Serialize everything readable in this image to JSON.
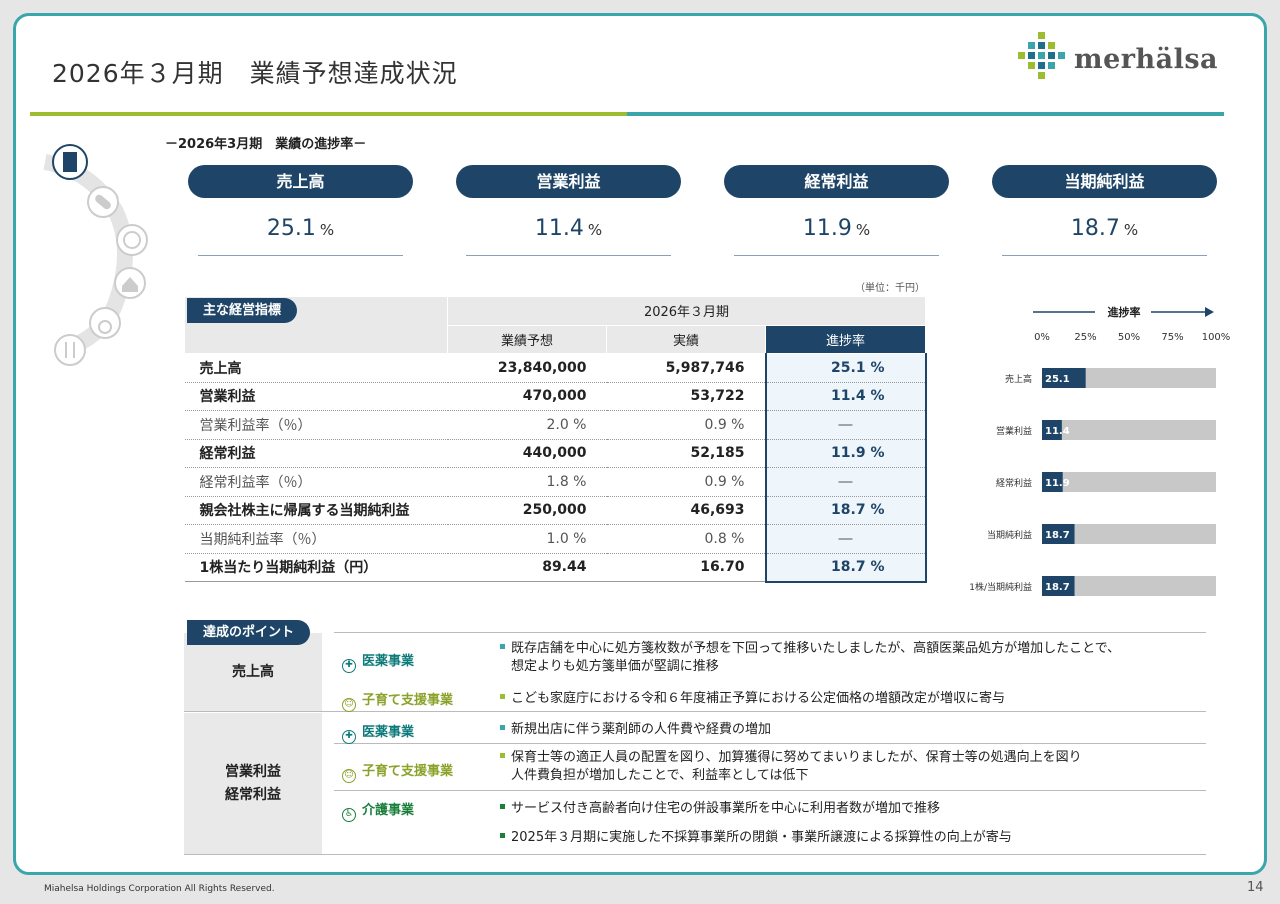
{
  "title": "2026年３月期　業績予想達成状況",
  "logo_text": "merhälsa",
  "section_label": "－2026年3月期　業績の進捗率－",
  "kpis": [
    {
      "label": "売上高",
      "value": "25.1",
      "unit": "%"
    },
    {
      "label": "営業利益",
      "value": "11.4",
      "unit": "%"
    },
    {
      "label": "経常利益",
      "value": "11.9",
      "unit": "%"
    },
    {
      "label": "当期純利益",
      "value": "18.7",
      "unit": "%"
    }
  ],
  "indicators": {
    "tag": "主な経営指標",
    "unit_note": "（単位：千円）",
    "period_header": "2026年３月期",
    "col_forecast": "業績予想",
    "col_actual": "実績",
    "col_progress": "進捗率",
    "rows": [
      {
        "label": "売上高",
        "forecast": "23,840,000",
        "actual": "5,987,746",
        "progress": "25.1 %"
      },
      {
        "label": "営業利益",
        "forecast": "470,000",
        "actual": "53,722",
        "progress": "11.4 %"
      },
      {
        "label": "営業利益率（％）",
        "forecast": "2.0 %",
        "actual": "0.9 %",
        "progress": "―"
      },
      {
        "label": "経常利益",
        "forecast": "440,000",
        "actual": "52,185",
        "progress": "11.9 %"
      },
      {
        "label": "経常利益率（％）",
        "forecast": "1.8 %",
        "actual": "0.9 %",
        "progress": "―"
      },
      {
        "label": "親会社株主に帰属する当期純利益",
        "forecast": "250,000",
        "actual": "46,693",
        "progress": "18.7 %"
      },
      {
        "label": "当期純利益率（％）",
        "forecast": "1.0 %",
        "actual": "0.8 %",
        "progress": "―"
      },
      {
        "label": "1株当たり当期純利益（円）",
        "forecast": "89.44",
        "actual": "16.70",
        "progress": "18.7 %"
      }
    ]
  },
  "chart_data": {
    "type": "bar",
    "orientation": "horizontal",
    "title": "進捗率",
    "categories": [
      "売上高",
      "営業利益",
      "経常利益",
      "当期純利益",
      "1株/当期純利益"
    ],
    "values": [
      25.1,
      11.4,
      11.9,
      18.7,
      18.7
    ],
    "value_labels": [
      "25.1",
      "11.4",
      "11.9",
      "18.7",
      "18.7"
    ],
    "xlim": [
      0,
      100
    ],
    "ticks": [
      "0%",
      "25%",
      "50%",
      "75%",
      "100%"
    ],
    "bar_color": "#1e4568",
    "track_color": "#c8c8c8"
  },
  "points": {
    "tag": "達成のポイント",
    "sales_label": "売上高",
    "profit_label_1": "営業利益",
    "profit_label_2": "経常利益",
    "seg_pharma": "医薬事業",
    "seg_childcare": "子育て支援事業",
    "seg_care": "介護事業",
    "sales_pharma_1": "既存店舗を中心に処方箋枚数が予想を下回って推移いたしましたが、高額医薬品処方が増加したことで、",
    "sales_pharma_2": "想定よりも処方箋単価が堅調に推移",
    "sales_childcare": "こども家庭庁における令和６年度補正予算における公定価格の増額改定が増収に寄与",
    "profit_pharma": "新規出店に伴う薬剤師の人件費や経費の増加",
    "profit_childcare_1": "保育士等の適正人員の配置を図り、加算獲得に努めてまいりましたが、保育士等の処遇向上を図り",
    "profit_childcare_2": "人件費負担が増加したことで、利益率としては低下",
    "profit_care_1": "サービス付き高齢者向け住宅の併設事業所を中心に利用者数が増加で推移",
    "profit_care_2": "2025年３月期に実施した不採算事業所の閉鎖・事業所譲渡による採算性の向上が寄与"
  },
  "colors": {
    "navy": "#1e4568",
    "teal": "#3aa5ab",
    "green": "#9cbd2d",
    "pharma": "#0e7a7a",
    "childcare": "#8aa22a",
    "care": "#1a7f3a"
  },
  "footer": "Miahelsa Holdings Corporation All Rights Reserved.",
  "page_number": "14"
}
